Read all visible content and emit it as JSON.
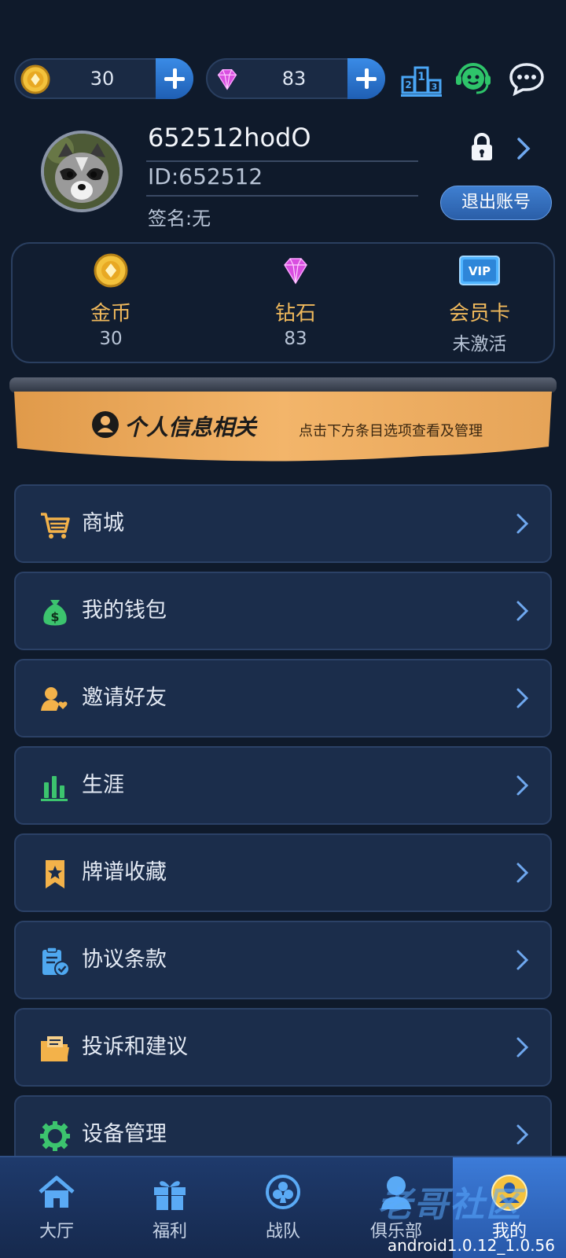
{
  "topbar": {
    "coin_value": "30",
    "diamond_value": "83",
    "icons": [
      "coin-icon",
      "diamond-icon",
      "add-icon",
      "ranking-icon",
      "customer-service-icon",
      "chat-icon"
    ]
  },
  "profile": {
    "username": "652512hodO",
    "id_text": "ID:652512",
    "signature": "签名:无",
    "logout_label": "退出账号"
  },
  "assets": [
    {
      "label": "金币",
      "value": "30",
      "icon": "coin-icon"
    },
    {
      "label": "钻石",
      "value": "83",
      "icon": "diamond-icon"
    },
    {
      "label": "会员卡",
      "value": "未激活",
      "icon": "vip-card-icon"
    }
  ],
  "banner": {
    "title": "个人信息相关",
    "subtitle": "点击下方条目选项查看及管理"
  },
  "menu": [
    {
      "label": "商城",
      "icon": "cart-icon"
    },
    {
      "label": "我的钱包",
      "icon": "money-bag-icon"
    },
    {
      "label": "邀请好友",
      "icon": "invite-friend-icon"
    },
    {
      "label": "生涯",
      "icon": "career-chart-icon"
    },
    {
      "label": "牌谱收藏",
      "icon": "bookmark-star-icon"
    },
    {
      "label": "协议条款",
      "icon": "clipboard-check-icon"
    },
    {
      "label": "投诉和建议",
      "icon": "folder-icon"
    },
    {
      "label": "设备管理",
      "icon": "gear-icon"
    }
  ],
  "nav": [
    {
      "label": "大厅",
      "icon": "home-icon"
    },
    {
      "label": "福利",
      "icon": "gift-icon"
    },
    {
      "label": "战队",
      "icon": "team-icon"
    },
    {
      "label": "俱乐部",
      "icon": "club-icon"
    },
    {
      "label": "我的",
      "icon": "profile-icon"
    }
  ],
  "nav_active": "我的",
  "version": "android1.0.12_1.0.56",
  "watermark": "老哥社区",
  "colors": {
    "background": "#0f1a2b",
    "card": "#1b2d4b",
    "accent_blue": "#2f74d0",
    "gold": "#f0b95c",
    "banner": "#e8a65a"
  }
}
